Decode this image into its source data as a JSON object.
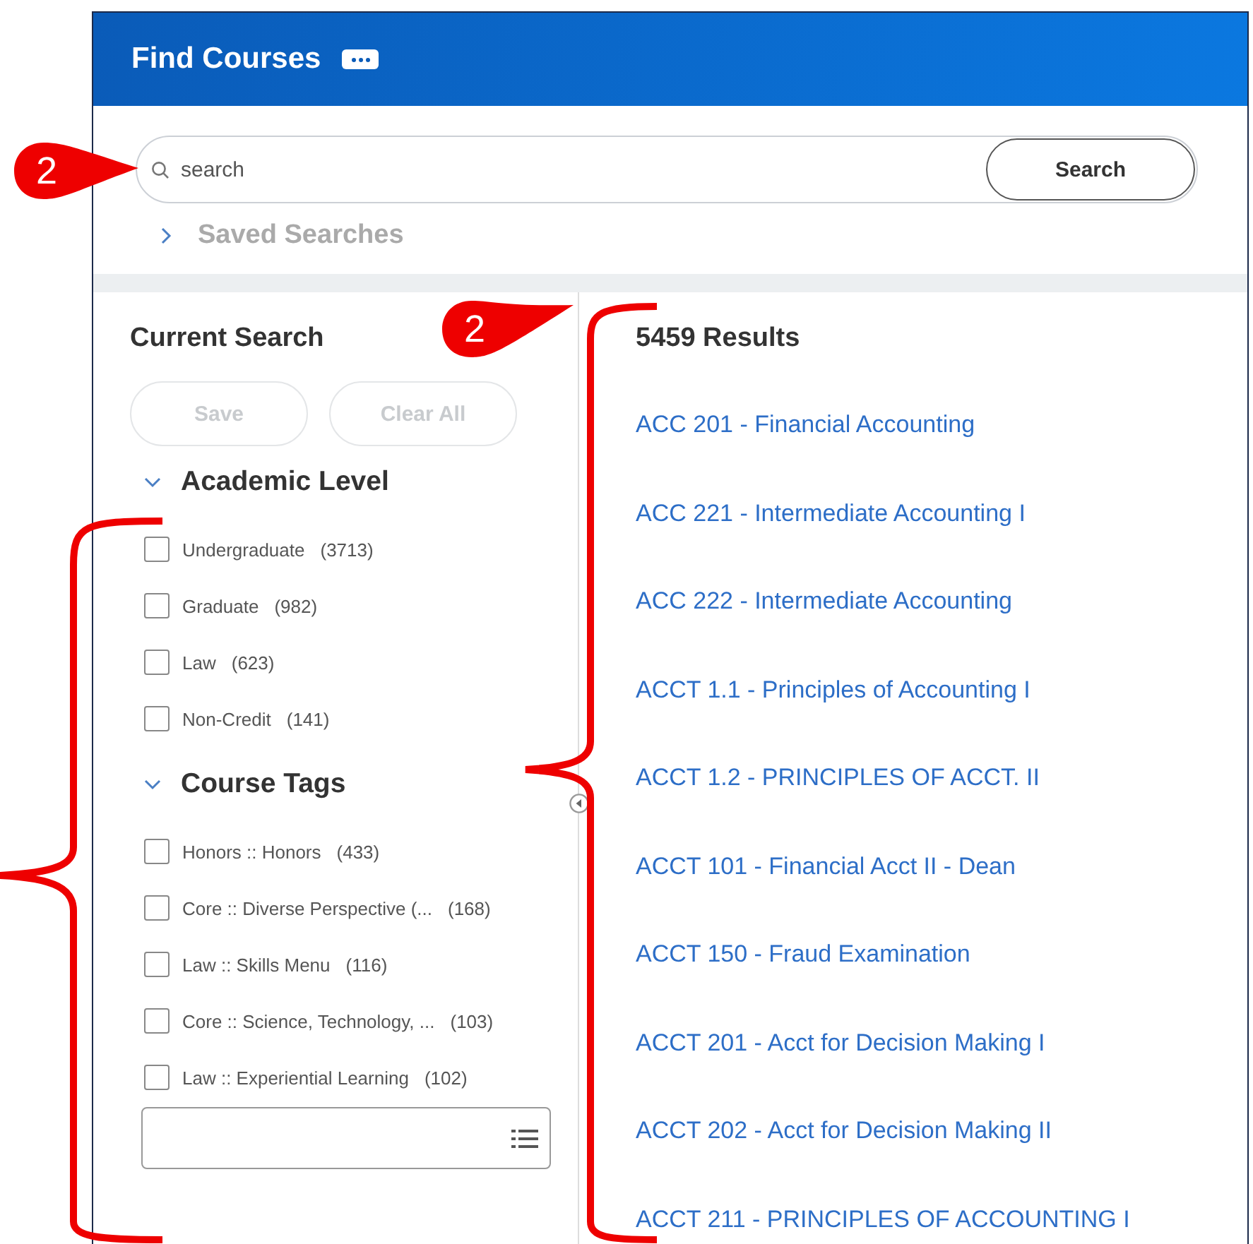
{
  "window": {
    "title": "Find Courses"
  },
  "search": {
    "placeholder": "search",
    "button": "Search"
  },
  "saved_searches": {
    "label": "Saved Searches",
    "expanded": false
  },
  "current_search": {
    "title": "Current Search",
    "buttons": [
      {
        "label": "Save",
        "disabled": true
      },
      {
        "label": "Clear All",
        "disabled": true
      }
    ]
  },
  "facets": [
    {
      "title": "Academic Level",
      "expanded": true,
      "options": [
        {
          "label": "Undergraduate",
          "count": "(3713)",
          "checked": false
        },
        {
          "label": "Graduate",
          "count": "(982)",
          "checked": false
        },
        {
          "label": "Law",
          "count": "(623)",
          "checked": false
        },
        {
          "label": "Non-Credit",
          "count": "(141)",
          "checked": false
        }
      ]
    },
    {
      "title": "Course Tags",
      "expanded": true,
      "options": [
        {
          "label": "Honors :: Honors",
          "count": "(433)",
          "checked": false
        },
        {
          "label": "Core :: Diverse Perspective (...",
          "count": "(168)",
          "checked": false
        },
        {
          "label": "Law :: Skills Menu",
          "count": "(116)",
          "checked": false
        },
        {
          "label": "Core :: Science, Technology, ...",
          "count": "(103)",
          "checked": false
        },
        {
          "label": "Law :: Experiential Learning",
          "count": "(102)",
          "checked": false
        }
      ]
    }
  ],
  "results": {
    "count": "5459 Results",
    "items": [
      "ACC 201 - Financial Accounting",
      "ACC 221 - Intermediate Accounting I",
      "ACC 222 - Intermediate Accounting",
      "ACCT 1.1 - Principles of Accounting I",
      "ACCT 1.2 - PRINCIPLES OF ACCT. II",
      "ACCT 101 - Financial Acct II - Dean",
      "ACCT 150 - Fraud Examination",
      "ACCT 201 - Acct for Decision Making I",
      "ACCT 202 - Acct for Decision Making II",
      "ACCT 211 - PRINCIPLES OF ACCOUNTING I"
    ]
  },
  "annotations": [
    {
      "kind": "callout",
      "text": "2"
    },
    {
      "kind": "callout",
      "text": "2"
    }
  ]
}
